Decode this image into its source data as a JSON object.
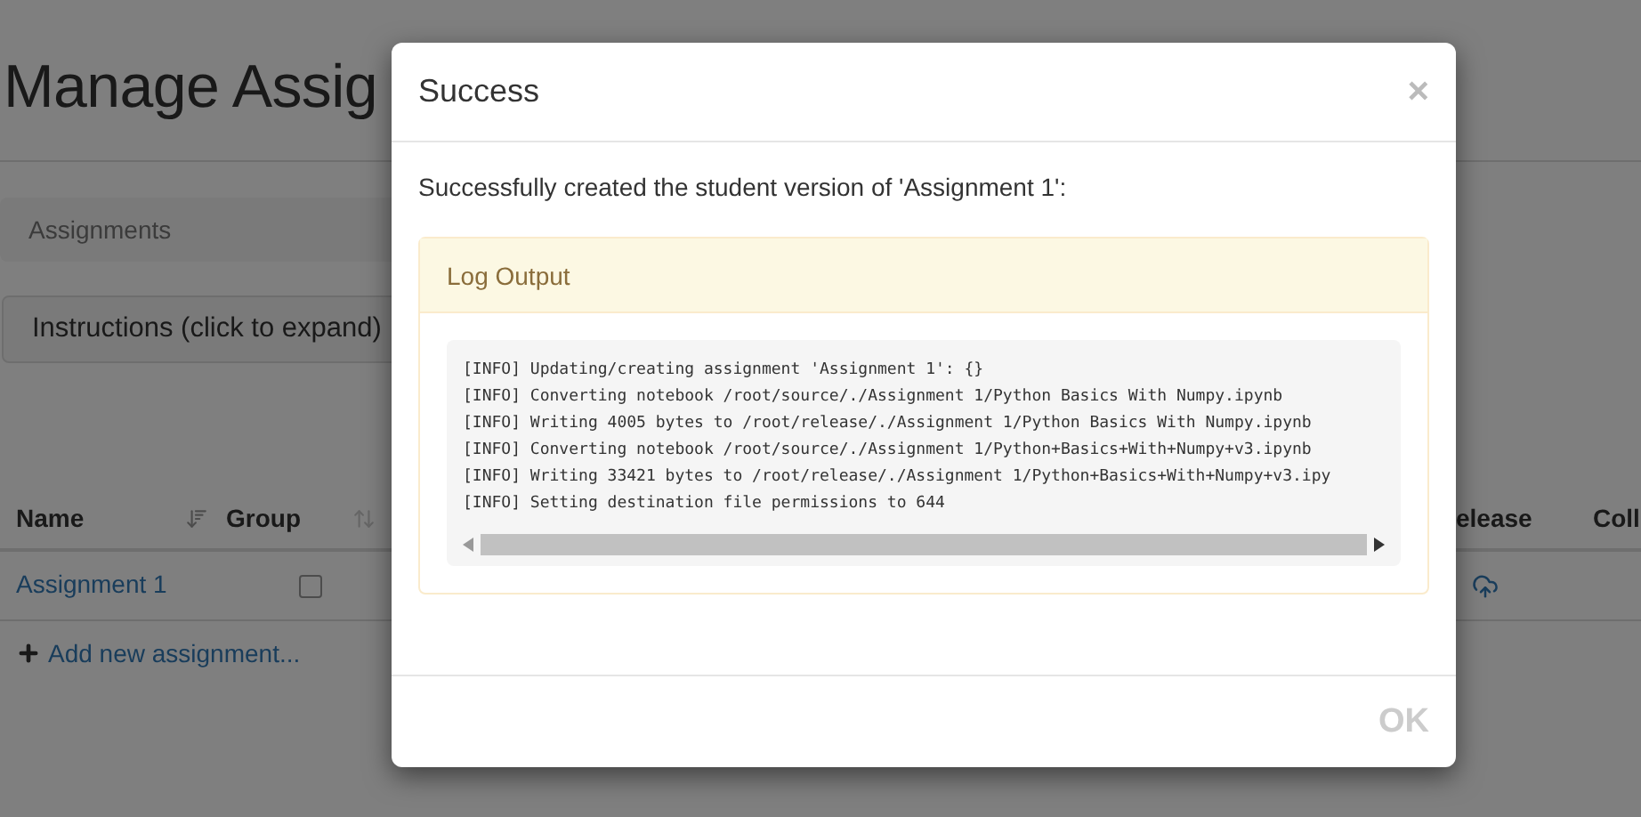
{
  "page": {
    "title": "Manage Assig",
    "breadcrumb": "Assignments",
    "instructions": "Instructions (click to expand)",
    "table": {
      "columns": [
        {
          "label": "Name",
          "sortable": true
        },
        {
          "label": "Group",
          "sortable": true
        }
      ],
      "right_columns": [
        "elease",
        "Coll"
      ],
      "rows": [
        {
          "name": "Assignment 1",
          "checked": false
        }
      ]
    },
    "add_link": "Add new assignment..."
  },
  "dialog": {
    "title": "Success",
    "close": "×",
    "message": "Successfully created the student version of 'Assignment 1':",
    "panel_title": "Log Output",
    "log": [
      "[INFO] Updating/creating assignment 'Assignment 1': {}",
      "[INFO] Converting notebook /root/source/./Assignment 1/Python Basics With Numpy.ipynb",
      "[INFO] Writing 4005 bytes to /root/release/./Assignment 1/Python Basics With Numpy.ipynb",
      "[INFO] Converting notebook /root/source/./Assignment 1/Python+Basics+With+Numpy+v3.ipynb",
      "[INFO] Writing 33421 bytes to /root/release/./Assignment 1/Python+Basics+With+Numpy+v3.ipy",
      "[INFO] Setting destination file permissions to 644"
    ],
    "ok": "OK",
    "ok_disabled": true
  }
}
